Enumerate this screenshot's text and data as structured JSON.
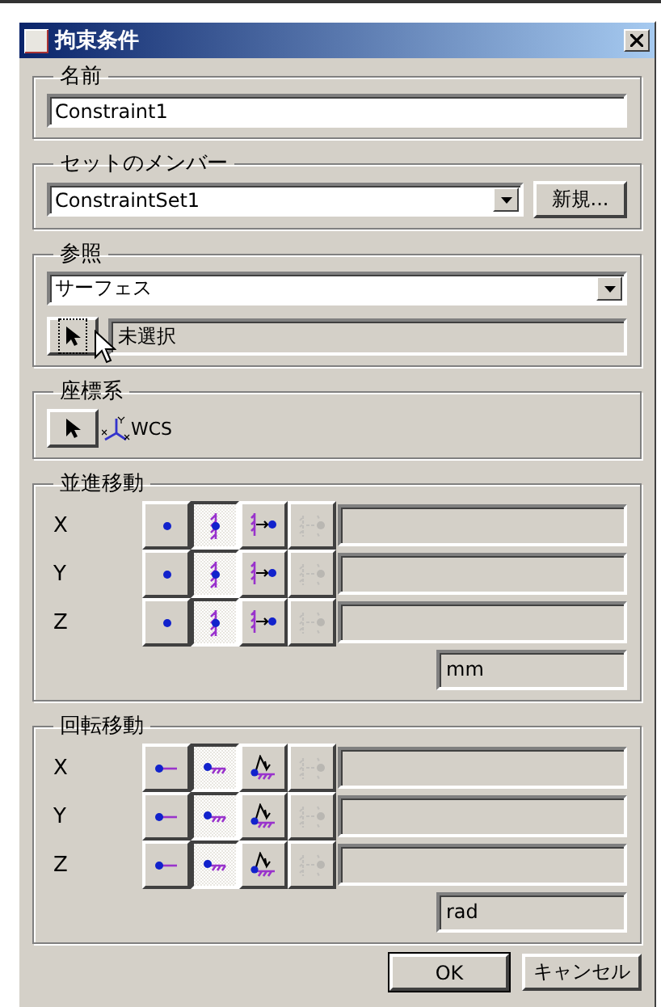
{
  "window": {
    "title": "拘束条件"
  },
  "name_group": {
    "label": "名前",
    "value": "Constraint1"
  },
  "set_group": {
    "label": "セットのメンバー",
    "value": "ConstraintSet1",
    "new_button": "新規..."
  },
  "reference_group": {
    "label": "参照",
    "type_value": "サーフェス",
    "selection": "未選択"
  },
  "coordinate_group": {
    "label": "座標系",
    "system": "WCS"
  },
  "motion_groups": [
    {
      "label": "並進移動",
      "kind": "translation",
      "unit": "mm",
      "rows": [
        {
          "axis": "X",
          "buttons": [
            {
              "kind": "free",
              "selected": false,
              "disabled": false
            },
            {
              "kind": "fixed",
              "selected": true,
              "disabled": false
            },
            {
              "kind": "move",
              "selected": false,
              "disabled": false
            },
            {
              "kind": "load",
              "selected": false,
              "disabled": true
            }
          ]
        },
        {
          "axis": "Y",
          "buttons": [
            {
              "kind": "free",
              "selected": false,
              "disabled": false
            },
            {
              "kind": "fixed",
              "selected": true,
              "disabled": false
            },
            {
              "kind": "move",
              "selected": false,
              "disabled": false
            },
            {
              "kind": "load",
              "selected": false,
              "disabled": true
            }
          ]
        },
        {
          "axis": "Z",
          "buttons": [
            {
              "kind": "free",
              "selected": false,
              "disabled": false
            },
            {
              "kind": "fixed",
              "selected": true,
              "disabled": false
            },
            {
              "kind": "move",
              "selected": false,
              "disabled": false
            },
            {
              "kind": "load",
              "selected": false,
              "disabled": true
            }
          ]
        }
      ]
    },
    {
      "label": "回転移動",
      "kind": "rotation",
      "unit": "rad",
      "rows": [
        {
          "axis": "X",
          "buttons": [
            {
              "kind": "free",
              "selected": false,
              "disabled": false
            },
            {
              "kind": "fixed",
              "selected": true,
              "disabled": false
            },
            {
              "kind": "move",
              "selected": false,
              "disabled": false
            },
            {
              "kind": "load",
              "selected": false,
              "disabled": true
            }
          ]
        },
        {
          "axis": "Y",
          "buttons": [
            {
              "kind": "free",
              "selected": false,
              "disabled": false
            },
            {
              "kind": "fixed",
              "selected": true,
              "disabled": false
            },
            {
              "kind": "move",
              "selected": false,
              "disabled": false
            },
            {
              "kind": "load",
              "selected": false,
              "disabled": true
            }
          ]
        },
        {
          "axis": "Z",
          "buttons": [
            {
              "kind": "free",
              "selected": false,
              "disabled": false
            },
            {
              "kind": "fixed",
              "selected": true,
              "disabled": false
            },
            {
              "kind": "move",
              "selected": false,
              "disabled": false
            },
            {
              "kind": "load",
              "selected": false,
              "disabled": true
            }
          ]
        }
      ]
    }
  ],
  "buttons": [
    {
      "label": "OK",
      "default": true
    },
    {
      "label": "キャンセル",
      "default": false
    }
  ]
}
